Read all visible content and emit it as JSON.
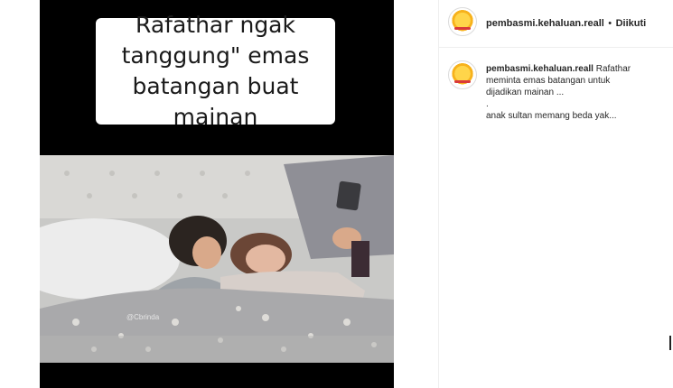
{
  "post": {
    "overlay_lines": [
      "Rafathar ngak",
      "tanggung\" emas",
      "batangan buat mainan"
    ],
    "watermark": "@Cbrinda"
  },
  "header": {
    "username": "pembasmi.kehaluan.reall",
    "separator": "•",
    "follow_label": "Diikuti"
  },
  "caption": {
    "username": "pembasmi.kehaluan.reall",
    "text_lines": [
      "Rafathar",
      "meminta emas batangan untuk",
      "dijadikan mainan ..."
    ],
    "dot_line": ".",
    "last_line": "anak sultan memang beda yak..."
  }
}
